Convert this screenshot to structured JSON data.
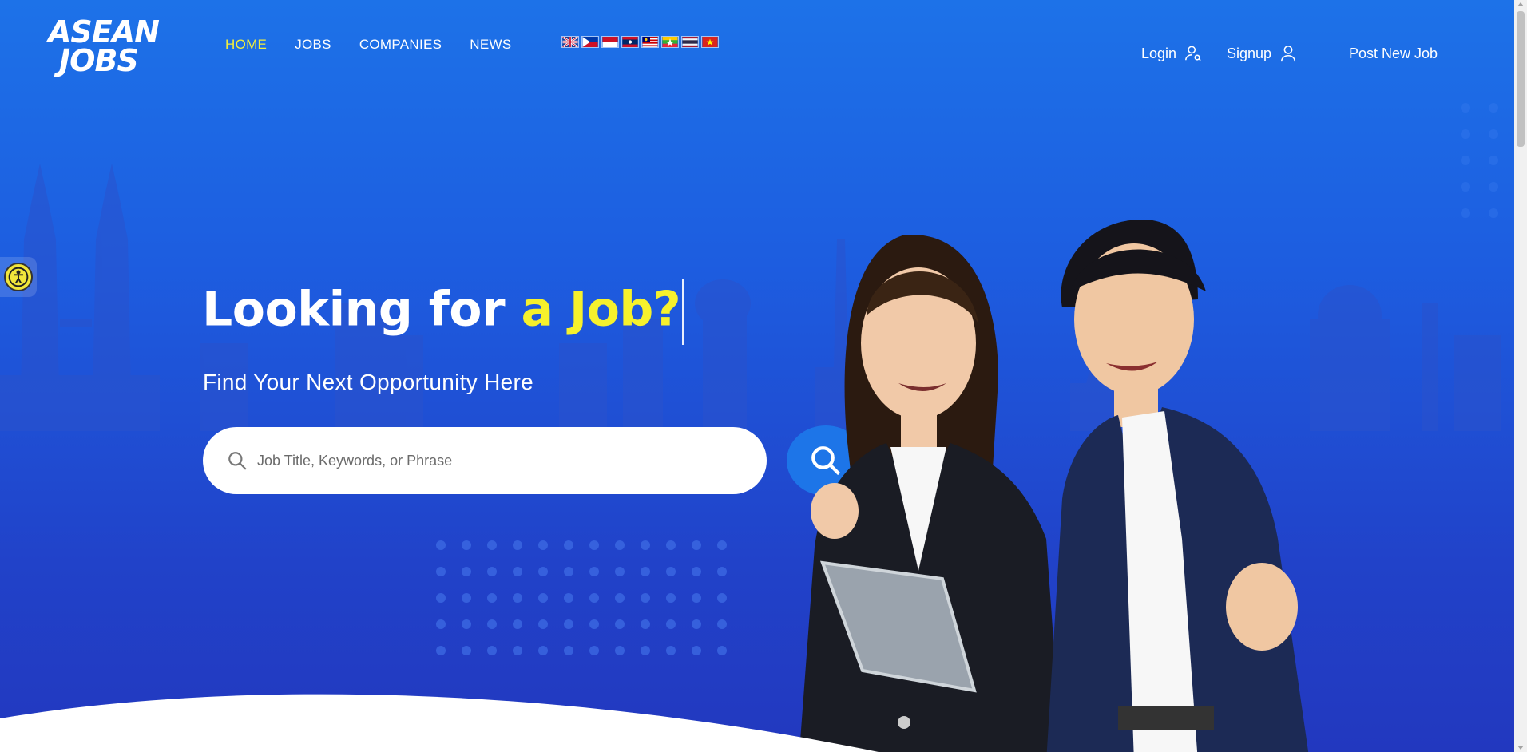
{
  "logo": {
    "line1": "ASEAN",
    "line2": "JOBS"
  },
  "nav": {
    "items": [
      {
        "label": "HOME",
        "active": true
      },
      {
        "label": "JOBS",
        "active": false
      },
      {
        "label": "COMPANIES",
        "active": false
      },
      {
        "label": "NEWS",
        "active": false
      }
    ]
  },
  "flags": [
    "gb",
    "ph",
    "id",
    "la",
    "my",
    "mm",
    "th",
    "vn"
  ],
  "header_right": {
    "login_label": "Login",
    "signup_label": "Signup",
    "post_job_label": "Post New Job"
  },
  "hero": {
    "headline_part1": "Looking for ",
    "headline_part2": "a Job?",
    "subheadline": "Find Your Next Opportunity Here",
    "search_placeholder": "Job Title, Keywords, or Phrase"
  },
  "colors": {
    "accent_yellow": "#f6f12c",
    "hero_blue": "#1d72e8",
    "search_button": "#1d75e8"
  }
}
